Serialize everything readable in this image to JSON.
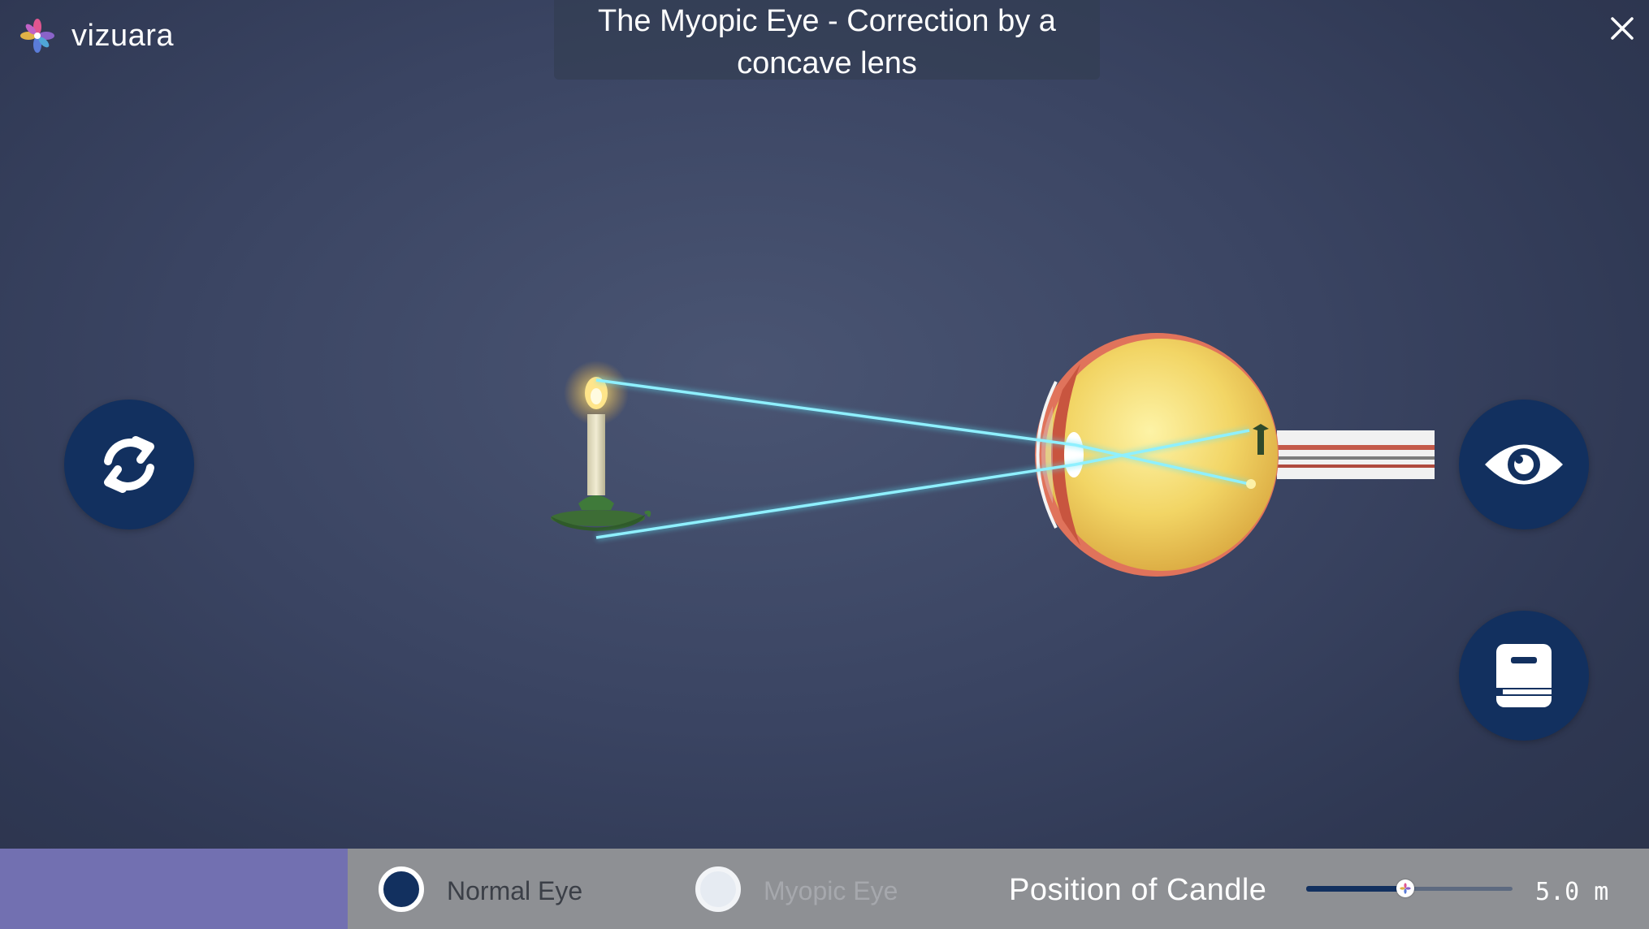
{
  "brand": {
    "name": "vizuara",
    "icon": "vizuara-flower-logo"
  },
  "header": {
    "title": "The Myopic Eye - Correction by a concave lens"
  },
  "controls": {
    "close_icon": "close-icon",
    "reset_icon": "rotate-reset-icon",
    "view_icon": "eye-icon",
    "info_icon": "book-icon"
  },
  "scene": {
    "objects": [
      "candle",
      "eyeball",
      "light-rays"
    ],
    "ray_color": "#5fe3f5"
  },
  "bottom_bar": {
    "options": [
      {
        "label": "Normal Eye",
        "selected": true
      },
      {
        "label": "Myopic Eye",
        "selected": false
      }
    ],
    "slider_label": "Position of Candle",
    "slider_value_text": "5.0 m",
    "slider_fraction": 0.48
  },
  "colors": {
    "button_bg": "#12305f",
    "bottom_bar": "#8e9094",
    "bottom_left_panel": "#7270b1",
    "background": "#333c57"
  }
}
